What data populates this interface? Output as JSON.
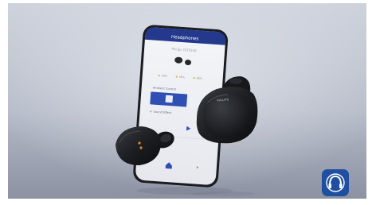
{
  "phone_app": {
    "title": "Headphones",
    "device_name": "Philips TAT5506",
    "battery_left": "56%",
    "battery_right": "56%",
    "battery_case": "90%",
    "noise_control_label": "Ambient Control",
    "sound_effect_label": "Sound Effect"
  },
  "earbud_brand": "PHILIPS",
  "app_icon": "headphones-icon",
  "colors": {
    "background_top": "#c9ced8",
    "background_bottom": "#8d93a3",
    "app_header": "#24398c",
    "app_accent": "#2f4fb5",
    "earbud": "#1d1f22",
    "app_icon_bg": "#1e4fa0"
  }
}
